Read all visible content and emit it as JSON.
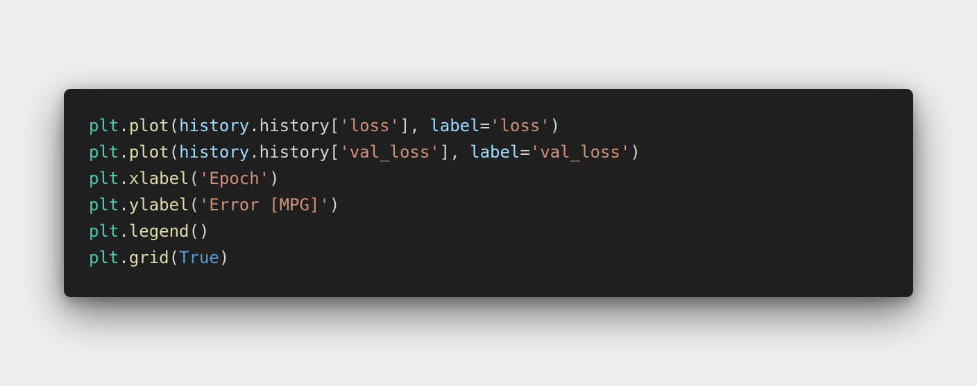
{
  "colors": {
    "page_background": "#efefef",
    "card_background": "#1f1f1f",
    "module": "#4ec9b0",
    "function": "#dcdcaa",
    "variable": "#9cdcfe",
    "string": "#ce9178",
    "keyword_constant": "#569cd6",
    "punctuation": "#d4d4d4"
  },
  "code_lines": [
    [
      {
        "text": "plt",
        "kind": "module"
      },
      {
        "text": ".",
        "kind": "punctuation"
      },
      {
        "text": "plot",
        "kind": "function"
      },
      {
        "text": "(",
        "kind": "punctuation"
      },
      {
        "text": "history",
        "kind": "variable"
      },
      {
        "text": ".history[",
        "kind": "punctuation"
      },
      {
        "text": "'loss'",
        "kind": "string"
      },
      {
        "text": "], ",
        "kind": "punctuation"
      },
      {
        "text": "label",
        "kind": "variable"
      },
      {
        "text": "=",
        "kind": "punctuation"
      },
      {
        "text": "'loss'",
        "kind": "string"
      },
      {
        "text": ")",
        "kind": "punctuation"
      }
    ],
    [
      {
        "text": "plt",
        "kind": "module"
      },
      {
        "text": ".",
        "kind": "punctuation"
      },
      {
        "text": "plot",
        "kind": "function"
      },
      {
        "text": "(",
        "kind": "punctuation"
      },
      {
        "text": "history",
        "kind": "variable"
      },
      {
        "text": ".history[",
        "kind": "punctuation"
      },
      {
        "text": "'val_loss'",
        "kind": "string"
      },
      {
        "text": "], ",
        "kind": "punctuation"
      },
      {
        "text": "label",
        "kind": "variable"
      },
      {
        "text": "=",
        "kind": "punctuation"
      },
      {
        "text": "'val_loss'",
        "kind": "string"
      },
      {
        "text": ")",
        "kind": "punctuation"
      }
    ],
    [
      {
        "text": "plt",
        "kind": "module"
      },
      {
        "text": ".",
        "kind": "punctuation"
      },
      {
        "text": "xlabel",
        "kind": "function"
      },
      {
        "text": "(",
        "kind": "punctuation"
      },
      {
        "text": "'Epoch'",
        "kind": "string"
      },
      {
        "text": ")",
        "kind": "punctuation"
      }
    ],
    [
      {
        "text": "plt",
        "kind": "module"
      },
      {
        "text": ".",
        "kind": "punctuation"
      },
      {
        "text": "ylabel",
        "kind": "function"
      },
      {
        "text": "(",
        "kind": "punctuation"
      },
      {
        "text": "'Error [MPG]'",
        "kind": "string"
      },
      {
        "text": ")",
        "kind": "punctuation"
      }
    ],
    [
      {
        "text": "plt",
        "kind": "module"
      },
      {
        "text": ".",
        "kind": "punctuation"
      },
      {
        "text": "legend",
        "kind": "function"
      },
      {
        "text": "()",
        "kind": "punctuation"
      }
    ],
    [
      {
        "text": "plt",
        "kind": "module"
      },
      {
        "text": ".",
        "kind": "punctuation"
      },
      {
        "text": "grid",
        "kind": "function"
      },
      {
        "text": "(",
        "kind": "punctuation"
      },
      {
        "text": "True",
        "kind": "keyword_constant"
      },
      {
        "text": ")",
        "kind": "punctuation"
      }
    ]
  ]
}
